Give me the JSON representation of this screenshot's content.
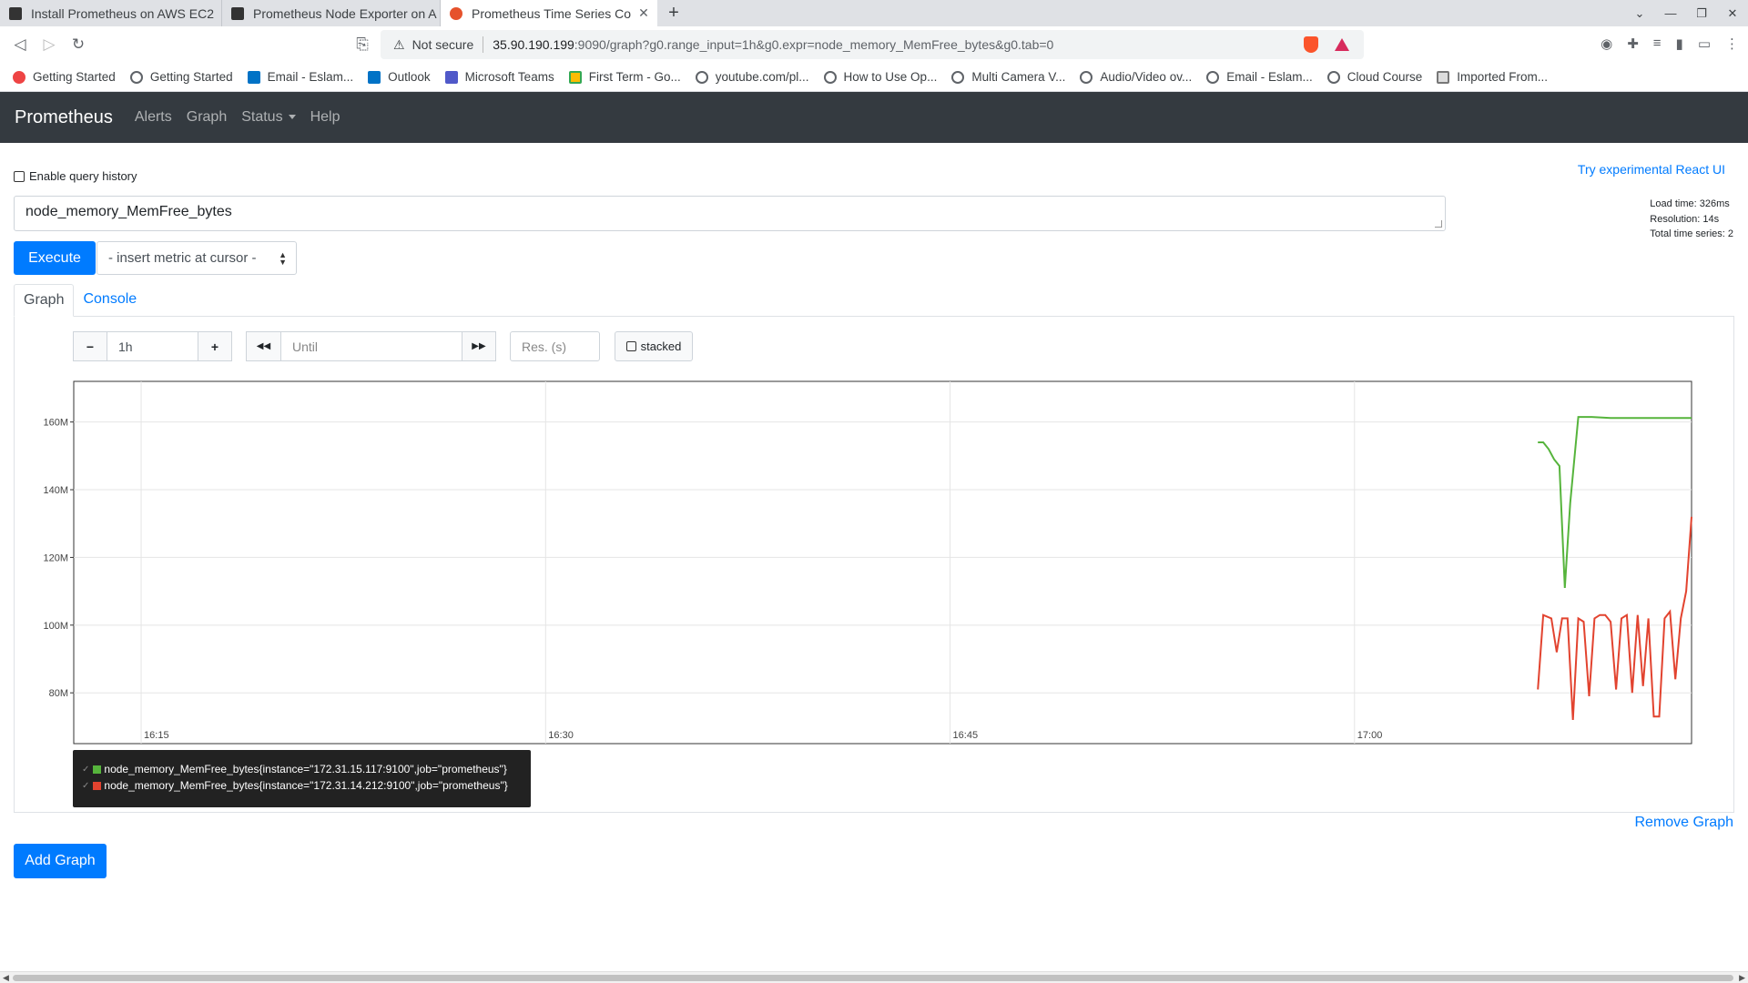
{
  "browser": {
    "tabs": [
      {
        "title": "Install Prometheus on AWS EC2",
        "active": false
      },
      {
        "title": "Prometheus Node Exporter on A",
        "active": false
      },
      {
        "title": "Prometheus Time Series Co",
        "active": true
      }
    ],
    "address": {
      "security_label": "Not secure",
      "host": "35.90.190.199",
      "rest": ":9090/graph?g0.range_input=1h&g0.expr=node_memory_MemFree_bytes&g0.tab=0"
    },
    "bookmarks": [
      "Getting Started",
      "Getting Started",
      "Email - Eslam...",
      "Outlook",
      "Microsoft Teams",
      "First Term - Go...",
      "youtube.com/pl...",
      "How to Use Op...",
      "Multi Camera V...",
      "Audio/Video ov...",
      "Email - Eslam...",
      "Cloud Course",
      "Imported From..."
    ]
  },
  "nav": {
    "brand": "Prometheus",
    "links": [
      "Alerts",
      "Graph",
      "Status",
      "Help"
    ]
  },
  "page": {
    "query_history_label": "Enable query history",
    "react_link": "Try experimental React UI",
    "stats": {
      "load_time": "Load time: 326ms",
      "resolution": "Resolution: 14s",
      "total_series": "Total time series: 2"
    },
    "expression": "node_memory_MemFree_bytes",
    "execute_label": "Execute",
    "metric_select": "- insert metric at cursor -",
    "tabs": [
      "Graph",
      "Console"
    ],
    "controls": {
      "minus": "−",
      "range": "1h",
      "plus": "+",
      "back": "◀◀",
      "until_placeholder": "Until",
      "forward": "▶▶",
      "res_placeholder": "Res. (s)",
      "stacked": "stacked"
    },
    "remove_graph": "Remove Graph",
    "add_graph": "Add Graph"
  },
  "chart_data": {
    "type": "line",
    "xlabel": "",
    "ylabel": "",
    "x_tick_labels": [
      "16:15",
      "16:30",
      "16:45",
      "17:00"
    ],
    "y_tick_labels": [
      "80M",
      "100M",
      "120M",
      "140M",
      "160M"
    ],
    "ylim": [
      65,
      172
    ],
    "xlim_minutes": [
      0,
      60
    ],
    "grid": true,
    "legend_position": "bottom-left",
    "series": [
      {
        "name": "node_memory_MemFree_bytes{instance=\"172.31.15.117:9100\",job=\"prometheus\"}",
        "color": "#56b43c",
        "x_minutes": [
          54.3,
          54.5,
          54.7,
          54.9,
          55.1,
          55.3,
          55.5,
          55.8,
          56.0,
          56.3,
          57.0,
          58.0,
          59.0,
          60.0
        ],
        "values": [
          154,
          154,
          152,
          149,
          147,
          111,
          136,
          161.5,
          161.5,
          161.5,
          161.2,
          161.2,
          161.2,
          161.2
        ]
      },
      {
        "name": "node_memory_MemFree_bytes{instance=\"172.31.14.212:9100\",job=\"prometheus\"}",
        "color": "#e2432f",
        "x_minutes": [
          54.3,
          54.5,
          54.8,
          55.0,
          55.2,
          55.4,
          55.6,
          55.8,
          56.0,
          56.2,
          56.4,
          56.6,
          56.8,
          57.0,
          57.2,
          57.4,
          57.6,
          57.8,
          58.0,
          58.2,
          58.4,
          58.6,
          58.8,
          59.0,
          59.2,
          59.4,
          59.6,
          59.8,
          60.0
        ],
        "values": [
          81,
          103,
          102,
          92,
          102,
          102,
          72,
          102,
          101,
          79,
          102,
          103,
          103,
          101,
          81,
          102,
          103,
          80,
          103,
          82,
          102,
          73,
          73,
          102,
          104,
          84,
          102,
          110,
          132
        ]
      }
    ]
  }
}
